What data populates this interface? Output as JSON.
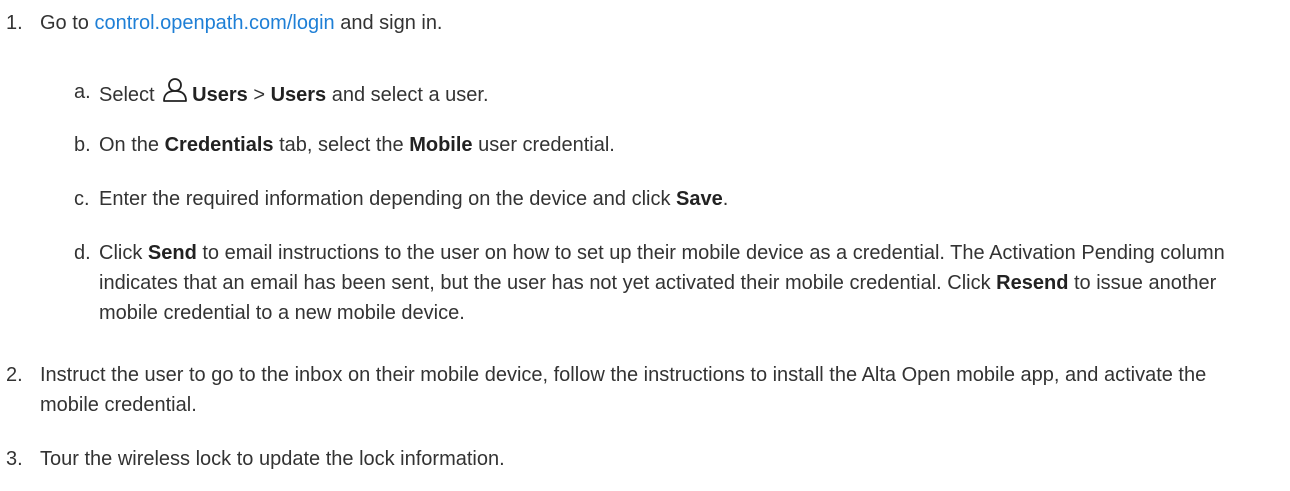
{
  "steps": [
    {
      "num": "1.",
      "pre": "Go to ",
      "link": "control.openpath.com/login",
      "post": " and sign in.",
      "substeps": [
        {
          "letter": "a.",
          "t1": "Select ",
          "icon": "user-icon",
          "b1": "Users",
          "t2": " > ",
          "b2": "Users",
          "t3": " and select a user."
        },
        {
          "letter": "b.",
          "t1": "On the ",
          "b1": "Credentials",
          "t2": " tab, select the ",
          "b2": "Mobile",
          "t3": " user credential."
        },
        {
          "letter": "c.",
          "t1": "Enter the required information depending on the device and click ",
          "b1": "Save",
          "t2": "."
        },
        {
          "letter": "d.",
          "t1": "Click ",
          "b1": "Send",
          "t2": " to email instructions to the user on how to set up their mobile device as a credential. The Activation Pending column indicates that an email has been sent, but the user has not yet activated their mobile credential. Click ",
          "b2": "Resend",
          "t3": " to issue another mobile credential to a new mobile device."
        }
      ]
    },
    {
      "num": "2.",
      "text": "Instruct the user to go to the inbox on their mobile device, follow the instructions to install the Alta Open mobile app, and activate the mobile credential."
    },
    {
      "num": "3.",
      "text": "Tour the wireless lock to update the lock information."
    }
  ],
  "colors": {
    "link": "#1e7fd6",
    "text": "#333333"
  }
}
